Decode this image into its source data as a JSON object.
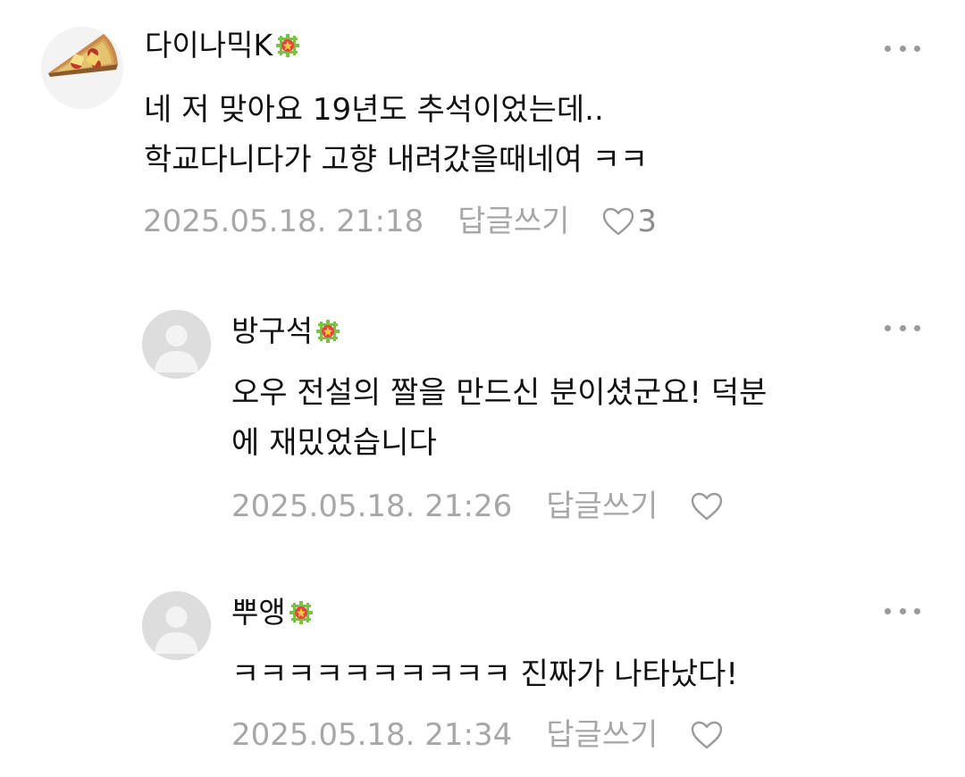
{
  "comments": [
    {
      "author": "다이나믹K",
      "avatar": "pizza-slice-avatar",
      "badge_icon": "green-grade-badge-icon",
      "lines": [
        "네 저 맞아요 19년도 추석이었는데..",
        "학교다니다가 고향 내려갔을때네여 ㅋㅋ"
      ],
      "date": "2025.05.18. 21:18",
      "reply_label": "답글쓰기",
      "like_icon": "heart-outline-icon",
      "like_count": "3"
    },
    {
      "author": "방구석",
      "avatar": "default-person-avatar",
      "badge_icon": "green-grade-badge-icon",
      "lines": [
        "오우 전설의 짤을 만드신 분이셨군요! 덕분",
        "에 재밌었습니다"
      ],
      "date": "2025.05.18. 21:26",
      "reply_label": "답글쓰기",
      "like_icon": "heart-outline-icon",
      "like_count": ""
    },
    {
      "author": "뿌앵",
      "avatar": "default-person-avatar",
      "badge_icon": "green-grade-badge-icon",
      "lines": [
        "ㅋㅋㅋㅋㅋㅋㅋㅋㅋㅋ 진짜가 나타났다!"
      ],
      "date": "2025.05.18. 21:34",
      "reply_label": "답글쓰기",
      "like_icon": "heart-outline-icon",
      "like_count": ""
    }
  ],
  "more_icon": "more-horizontal-icon",
  "colors": {
    "text": "#111111",
    "meta": "#a7a7a7",
    "badge_green": "#7cc242",
    "badge_red": "#e2473b"
  }
}
